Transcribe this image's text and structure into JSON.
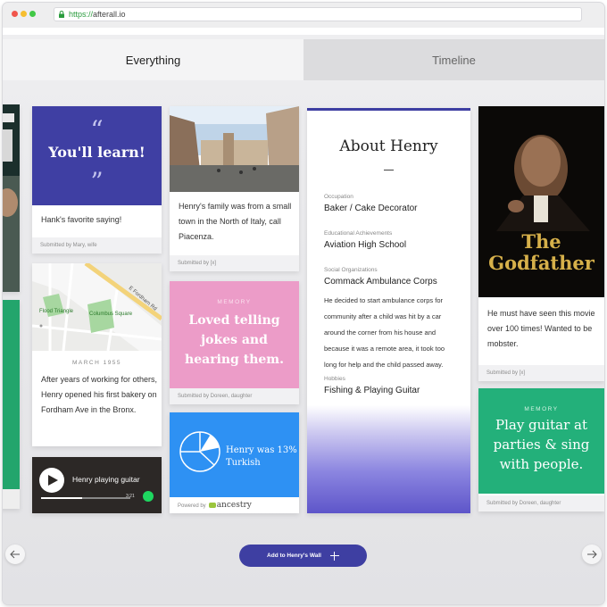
{
  "browser": {
    "url_scheme": "https://",
    "url_host": "afterall.io"
  },
  "tabs": [
    {
      "label": "Everything",
      "active": true
    },
    {
      "label": "Timeline",
      "active": false
    }
  ],
  "quote_card": {
    "quote": "You'll learn!",
    "caption": "Hank's favorite saying!",
    "submitted": "Submitted by Mary, wife",
    "color": "#3f3fa3"
  },
  "map_card": {
    "map_labels": [
      "Flood Triangle",
      "Columbus Square",
      "E Fordham Rd"
    ],
    "date": "MARCH 1955",
    "text": "After years of working for others, Henry opened his first bakery on Fordham Ave in the Bronx."
  },
  "spotify_card": {
    "title": "Henry playing guitar",
    "time": "3:21",
    "progress": 0.46
  },
  "photo_card": {
    "text": "Henry's family was from a small town in the North of Italy, call Piacenza.",
    "submitted": "Submitted by [x]"
  },
  "pink_memory": {
    "label": "MEMORY",
    "text": "Loved telling jokes and hearing them.",
    "submitted": "Submitted by Doreen, daughter",
    "color": "#ec9cc8"
  },
  "ancestry_card": {
    "text": "Henry was 13% Turkish",
    "powered_by": "Powered by",
    "brand": "ancestry",
    "percent": 13,
    "color": "#2e91f3"
  },
  "about": {
    "title": "About Henry",
    "fields": [
      {
        "label": "Occupation",
        "value": "Baker / Cake Decorator"
      },
      {
        "label": "Educational Achievements",
        "value": "Aviation High School"
      },
      {
        "label": "Social Organizations",
        "value": "Commack Ambulance Corps"
      }
    ],
    "story": "He decided to start ambulance corps for community after a child was hit by a car around the corner from his house and because it was a remote area, it took too long for help and the child passed away.",
    "hobbies_label": "Hobbies",
    "hobbies_value": "Fishing & Playing Guitar",
    "accent": "#3e3fa2"
  },
  "godfather_card": {
    "poster_title_1": "The",
    "poster_title_2": "Godfather",
    "text": "He must have seen this movie over 100 times! Wanted  to be mobster.",
    "submitted": "Submitted by [x]"
  },
  "green_memory": {
    "label": "MEMORY",
    "text": "Play guitar at parties & sing with people.",
    "submitted": "Submitted by Doreen, daughter",
    "color": "#23b07a"
  },
  "footer": {
    "add_button": "Add to Henry's Wall",
    "prev_icon": "arrow-left-icon",
    "next_icon": "arrow-right-icon"
  }
}
